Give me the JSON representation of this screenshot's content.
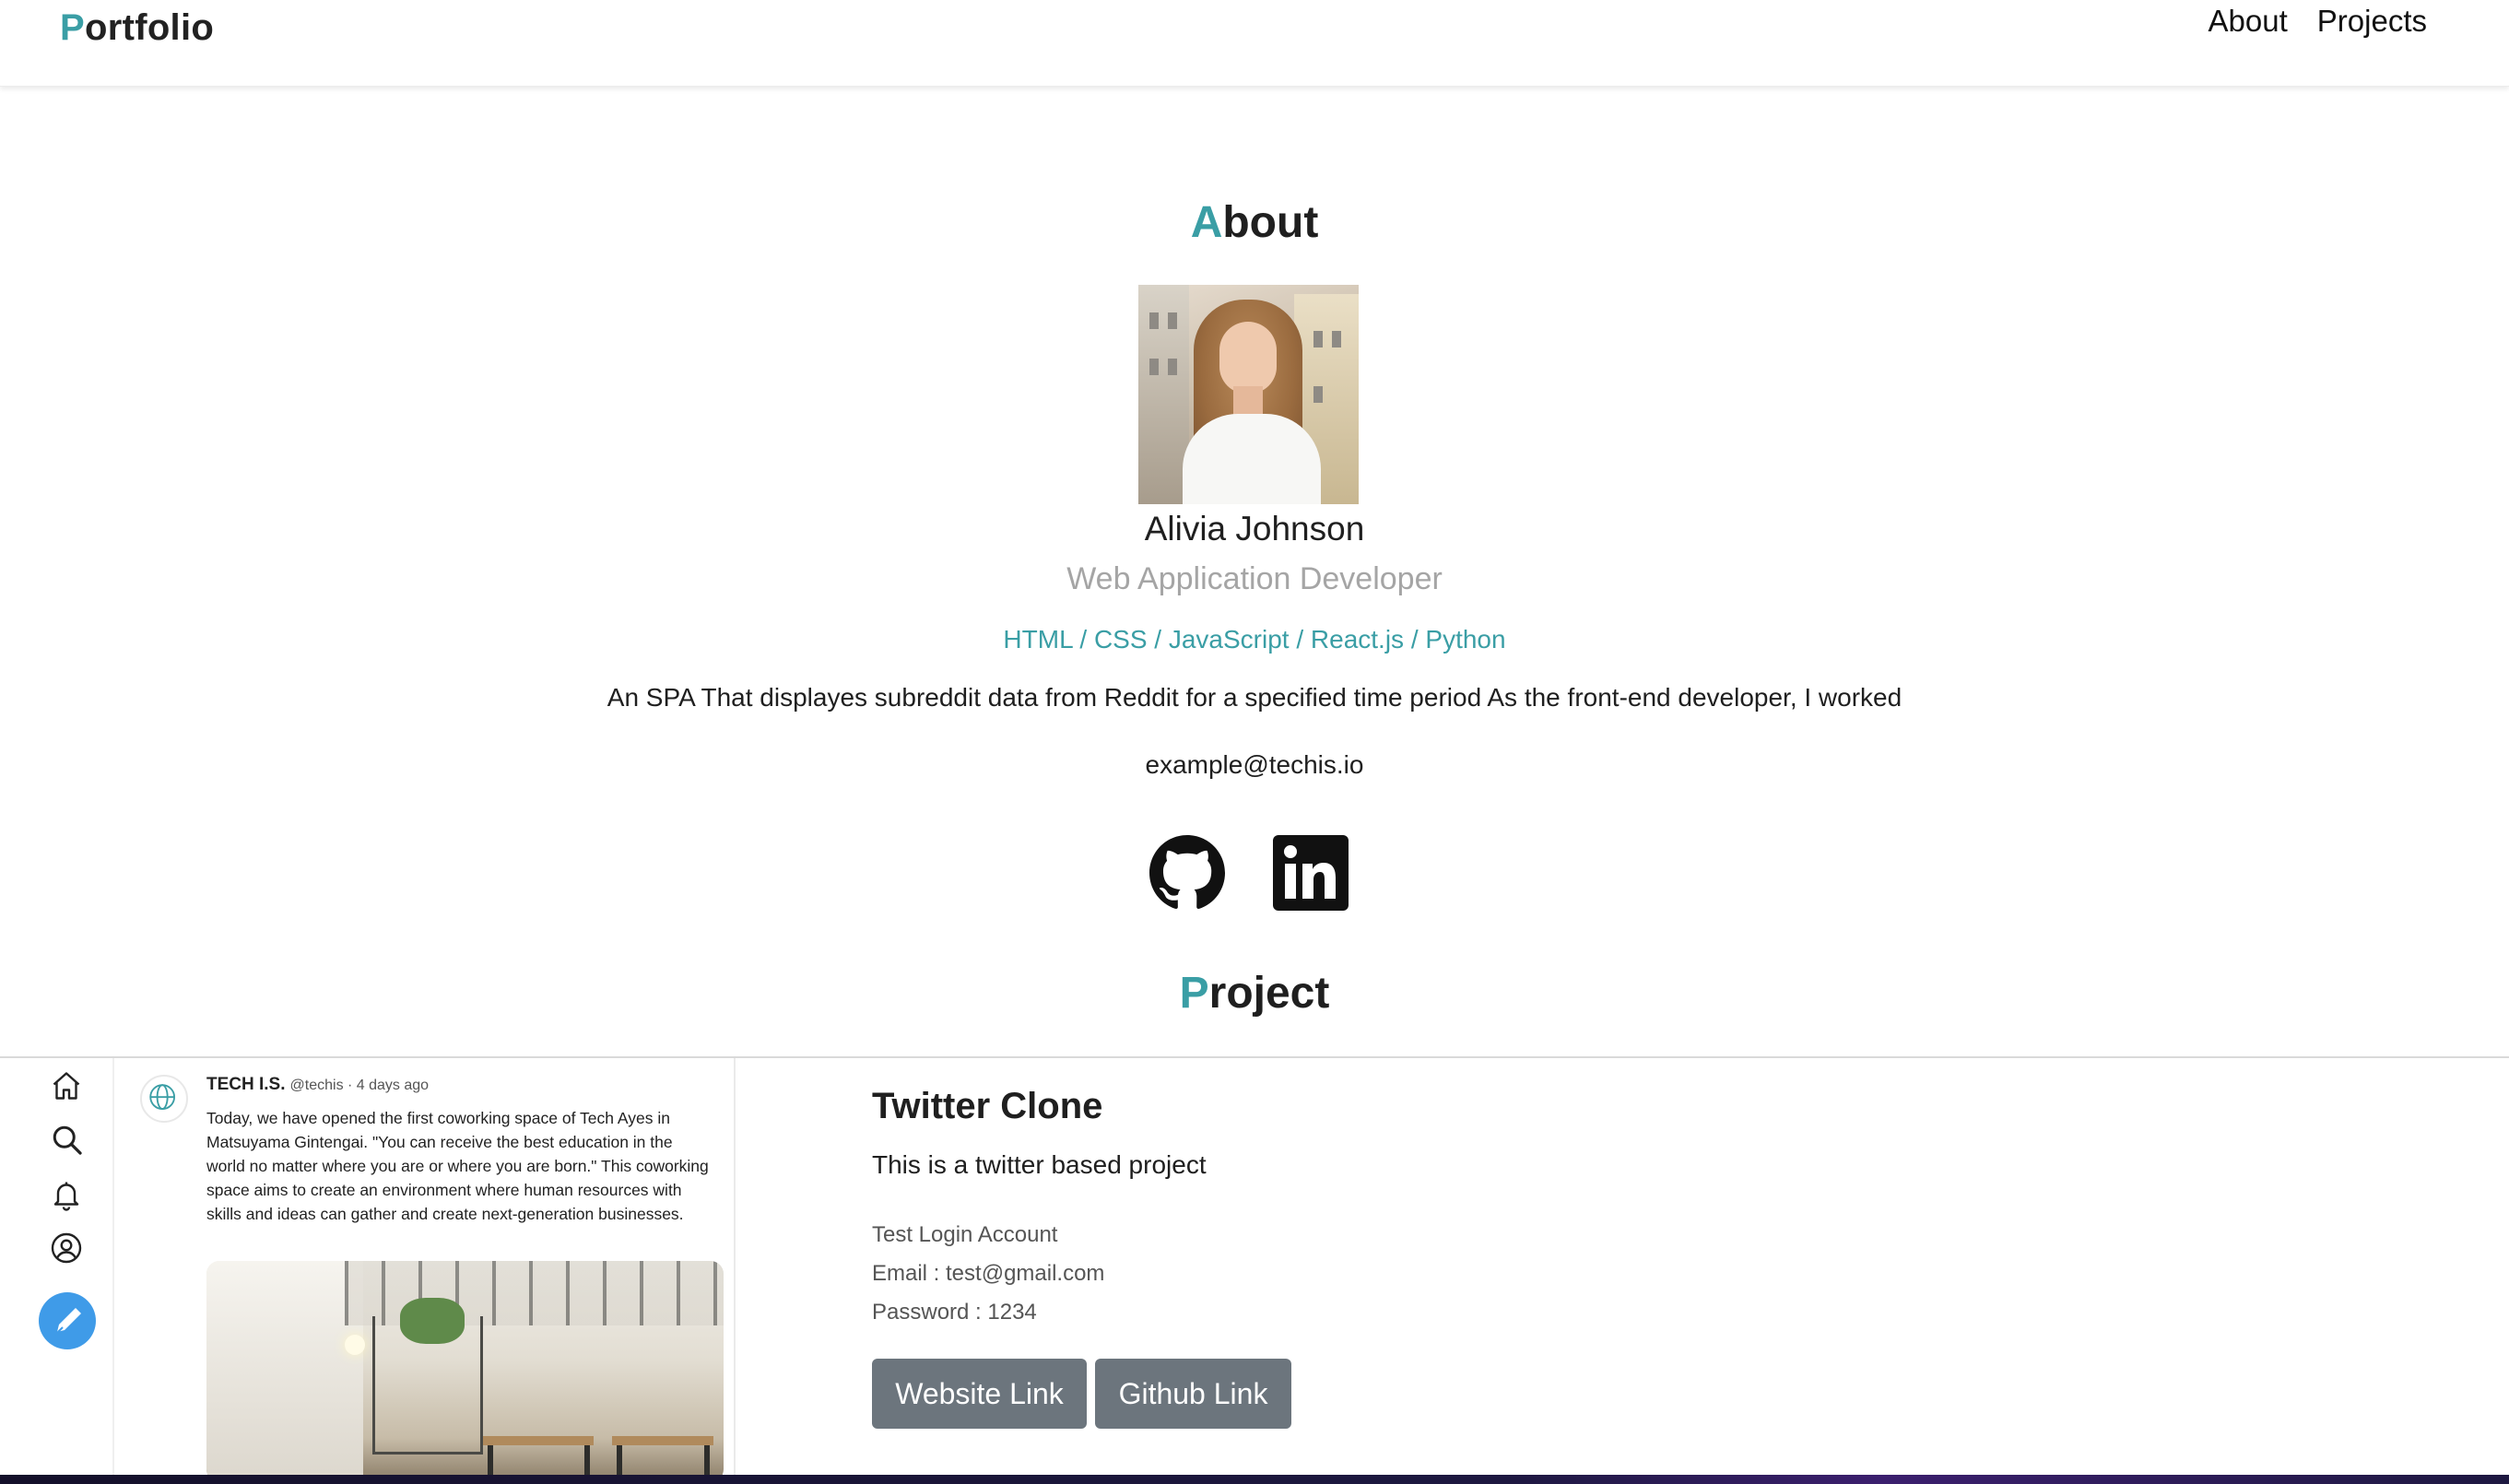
{
  "header": {
    "brand_initial": "P",
    "brand_rest": "ortfolio",
    "nav": [
      {
        "label": "About"
      },
      {
        "label": "Projects"
      }
    ]
  },
  "about": {
    "title_initial": "A",
    "title_rest": "bout",
    "name": "Alivia Johnson",
    "role": "Web Application Developer",
    "skills": "HTML / CSS / JavaScript / React.js / Python",
    "description": "An SPA That displayes subreddit data from Reddit for a specified time period As the front-end developer, I worked",
    "email": "example@techis.io",
    "social": [
      {
        "icon": "github-icon"
      },
      {
        "icon": "linkedin-icon"
      }
    ]
  },
  "projects_section": {
    "title_initial": "P",
    "title_rest": "roject"
  },
  "project": {
    "preview": {
      "author": "TECH I.S.",
      "handle": "@techis · 4 days ago",
      "tweet": "Today, we have opened the first coworking space of Tech Ayes in Matsuyama Gintengai. \"You can receive the best education in the world no matter where you are or where you are born.\" This coworking space aims to create an environment where human resources with skills and ideas can gather and create next-generation businesses.",
      "rail_icons": [
        "home-icon",
        "search-icon",
        "bell-icon",
        "profile-icon",
        "compose-icon"
      ]
    },
    "title": "Twitter Clone",
    "subtitle": "This is a twitter based project",
    "details": [
      "Test Login Account",
      "Email : test@gmail.com",
      "Password : 1234"
    ],
    "buttons": {
      "website": "Website Link",
      "github": "Github Link"
    }
  },
  "colors": {
    "accent": "#3a9ea5",
    "button": "#6c757d",
    "muted": "#a5a5a5",
    "compose": "#3f9be8"
  }
}
